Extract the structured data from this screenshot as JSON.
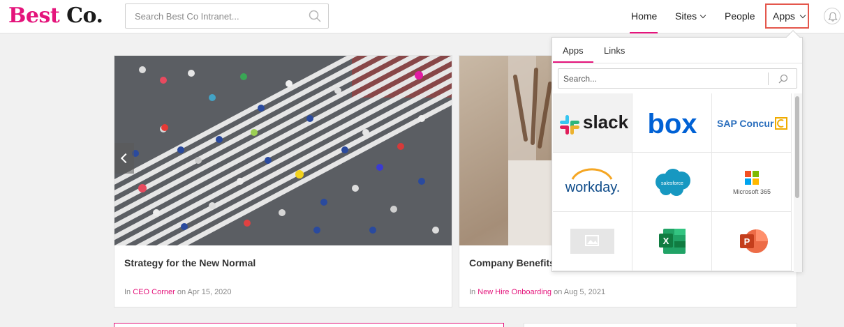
{
  "header": {
    "logo_brand": "Best",
    "logo_rest": "Co.",
    "search_placeholder": "Search Best Co Intranet...",
    "nav": {
      "home": "Home",
      "sites": "Sites",
      "people": "People",
      "apps": "Apps"
    },
    "icons": [
      "search-icon",
      "chevron-down-icon",
      "bell-icon"
    ]
  },
  "colors": {
    "brand": "#e4147b",
    "highlight_box": "#e4574c"
  },
  "cards": [
    {
      "title": "Strategy for the New Normal",
      "meta_prefix": "In",
      "category": "CEO Corner",
      "meta_mid": "on",
      "date": "Apr 15, 2020"
    },
    {
      "title": "Company Benefits",
      "meta_prefix": "In",
      "category": "New Hire Onboarding",
      "meta_mid": "on",
      "date": "Aug 5, 2021"
    }
  ],
  "apps_dropdown": {
    "tabs": [
      "Apps",
      "Links"
    ],
    "active_tab": "Apps",
    "search_placeholder": "Search...",
    "apps": [
      {
        "name": "slack",
        "label": "slack"
      },
      {
        "name": "box",
        "label": "box"
      },
      {
        "name": "sap-concur",
        "label": "SAP Concur"
      },
      {
        "name": "workday",
        "label": "workday."
      },
      {
        "name": "salesforce",
        "label": "salesforce"
      },
      {
        "name": "microsoft-365",
        "label": "Microsoft 365"
      },
      {
        "name": "placeholder-image",
        "label": ""
      },
      {
        "name": "excel",
        "label": "X"
      },
      {
        "name": "powerpoint",
        "label": "P"
      }
    ]
  }
}
